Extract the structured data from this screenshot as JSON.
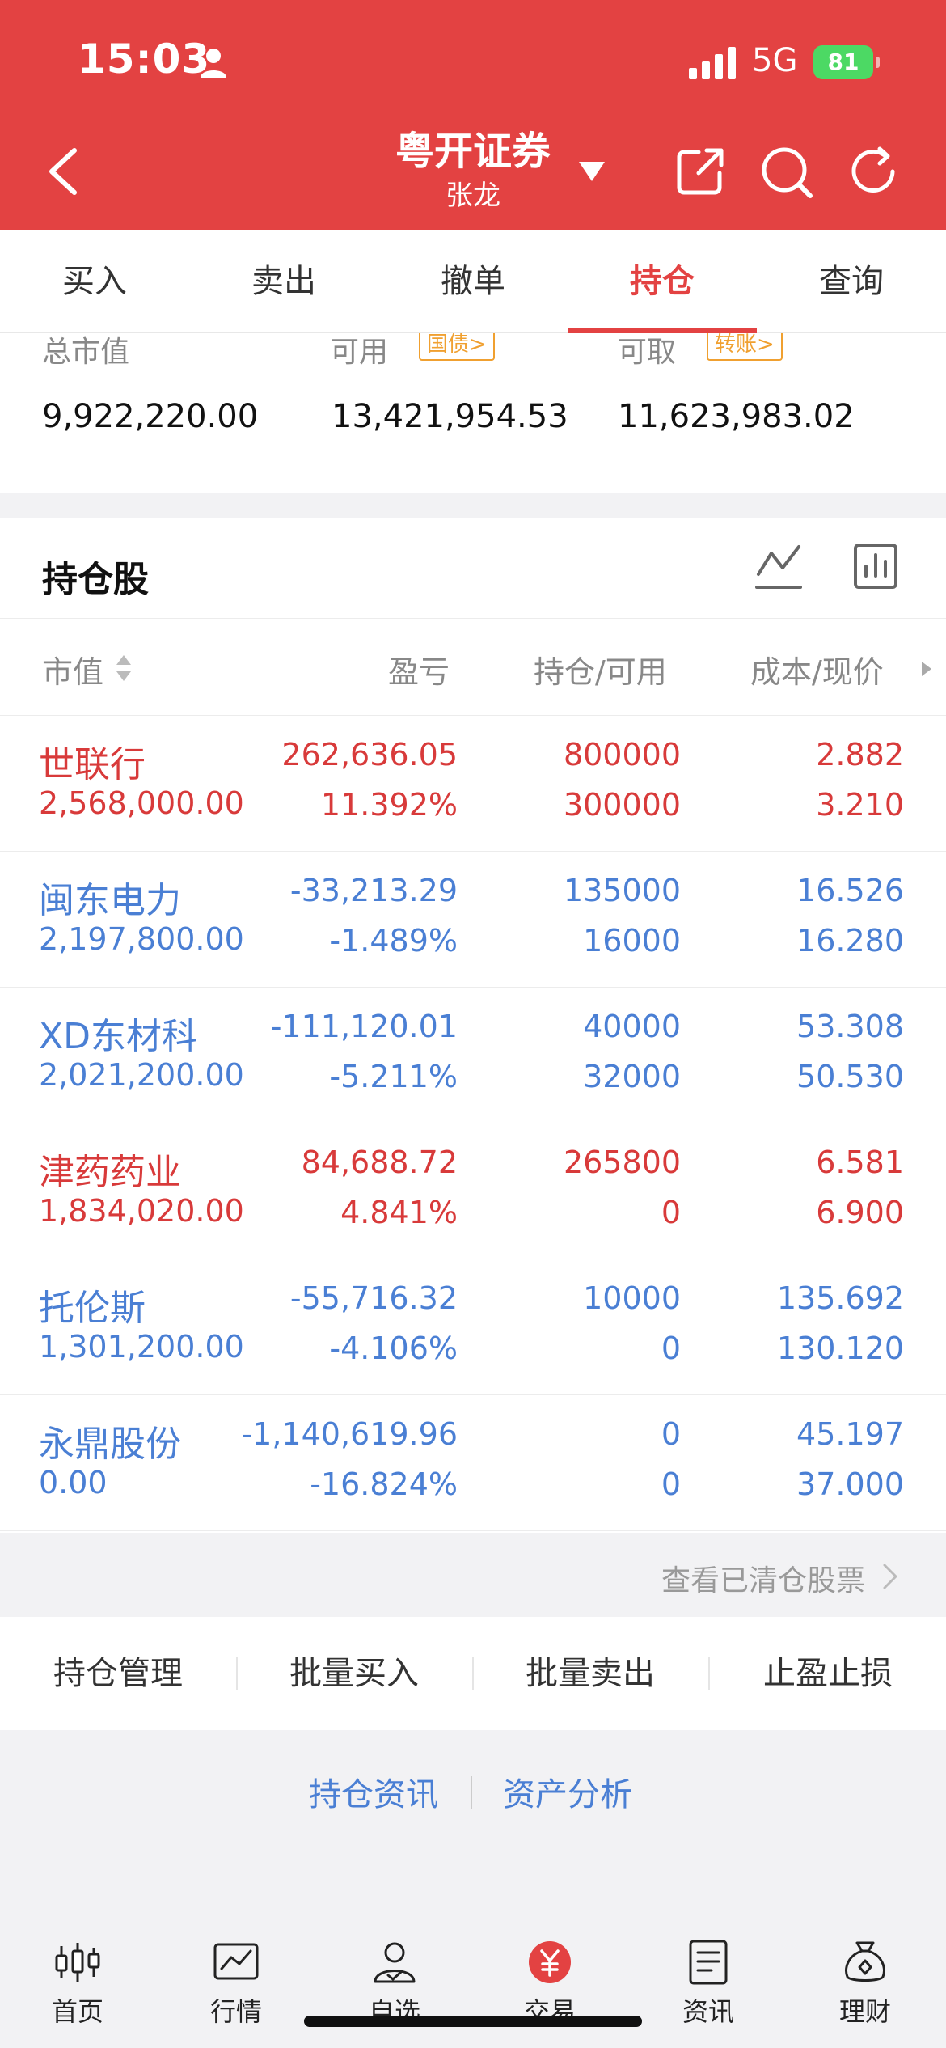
{
  "status_bar": {
    "time": "15:03",
    "network": "5G",
    "battery": "81"
  },
  "header": {
    "title": "粤开证券",
    "account_name": "张龙"
  },
  "tabs": [
    "买入",
    "卖出",
    "撤单",
    "持仓",
    "查询"
  ],
  "active_tab": "持仓",
  "summary": {
    "market_value_label": "总市值",
    "available_label": "可用",
    "available_tag": "国债>",
    "withdrawable_label": "可取",
    "withdrawable_tag": "转账>",
    "market_value": "9,922,220.00",
    "available": "13,421,954.53",
    "withdrawable": "11,623,983.02"
  },
  "holdings": {
    "title": "持仓股",
    "columns": {
      "value": "市值",
      "pnl": "盈亏",
      "position": "持仓/可用",
      "cost": "成本/现价"
    },
    "rows": [
      {
        "name": "世联行",
        "market_value": "2,568,000.00",
        "pnl": "262,636.05",
        "pnl_pct": "11.392%",
        "position": "800000",
        "available": "300000",
        "cost": "2.882",
        "price": "3.210",
        "trend": "up"
      },
      {
        "name": "闽东电力",
        "market_value": "2,197,800.00",
        "pnl": "-33,213.29",
        "pnl_pct": "-1.489%",
        "position": "135000",
        "available": "16000",
        "cost": "16.526",
        "price": "16.280",
        "trend": "down"
      },
      {
        "name": "XD东材科",
        "market_value": "2,021,200.00",
        "pnl": "-111,120.01",
        "pnl_pct": "-5.211%",
        "position": "40000",
        "available": "32000",
        "cost": "53.308",
        "price": "50.530",
        "trend": "down"
      },
      {
        "name": "津药药业",
        "market_value": "1,834,020.00",
        "pnl": "84,688.72",
        "pnl_pct": "4.841%",
        "position": "265800",
        "available": "0",
        "cost": "6.581",
        "price": "6.900",
        "trend": "up"
      },
      {
        "name": "托伦斯",
        "market_value": "1,301,200.00",
        "pnl": "-55,716.32",
        "pnl_pct": "-4.106%",
        "position": "10000",
        "available": "0",
        "cost": "135.692",
        "price": "130.120",
        "trend": "down"
      },
      {
        "name": "永鼎股份",
        "market_value": "0.00",
        "pnl": "-1,140,619.96",
        "pnl_pct": "-16.824%",
        "position": "0",
        "available": "0",
        "cost": "45.197",
        "price": "37.000",
        "trend": "down"
      }
    ]
  },
  "cleared_link": "查看已清仓股票",
  "actions": [
    "持仓管理",
    "批量买入",
    "批量卖出",
    "止盈止损"
  ],
  "links": [
    "持仓资讯",
    "资产分析"
  ],
  "tabbar": [
    "首页",
    "行情",
    "自选",
    "交易",
    "资讯",
    "理财"
  ],
  "colors": {
    "brand_red": "#e34242",
    "up": "#d83a3a",
    "down": "#4a7fd4",
    "tag_orange": "#f0a030"
  }
}
